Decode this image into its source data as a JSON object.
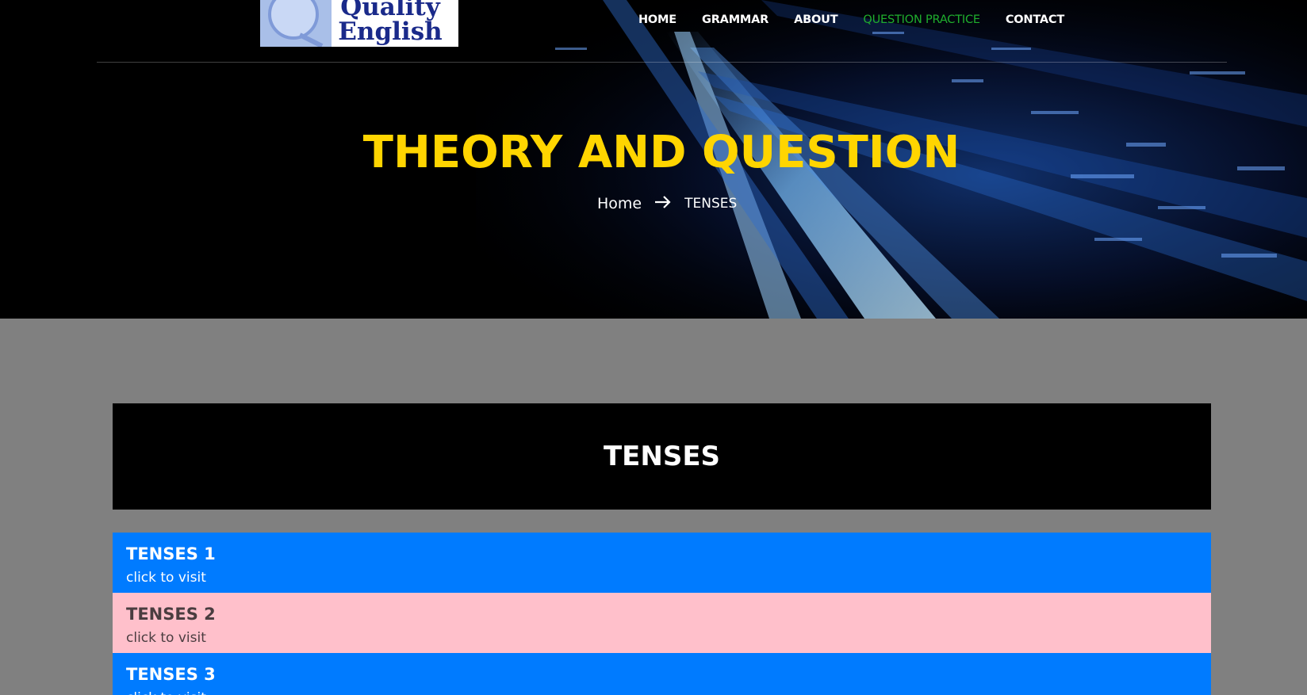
{
  "logo": {
    "line1": "Quality",
    "line2": "English"
  },
  "nav": {
    "items": [
      {
        "label": "HOME"
      },
      {
        "label": "GRAMMAR"
      },
      {
        "label": "ABOUT"
      },
      {
        "label": "QUESTION PRACTICE"
      },
      {
        "label": "CONTACT"
      }
    ],
    "active_index": 3
  },
  "hero": {
    "title": "THEORY AND QUESTION",
    "breadcrumb": {
      "home": "Home",
      "arrow_icon": "arrow-right-icon",
      "current": "TENSES"
    }
  },
  "section": {
    "title": "TENSES"
  },
  "items": [
    {
      "title": "TENSES 1",
      "subtitle": "click to visit",
      "color": "#007bff"
    },
    {
      "title": "TENSES 2",
      "subtitle": "click to visit",
      "color": "#ffc0cb"
    },
    {
      "title": "TENSES 3",
      "subtitle": "click to visit",
      "color": "#007bff"
    }
  ],
  "colors": {
    "accent_title": "#ffd500",
    "nav_active": "#1fae2d",
    "page_bg": "#808080"
  }
}
